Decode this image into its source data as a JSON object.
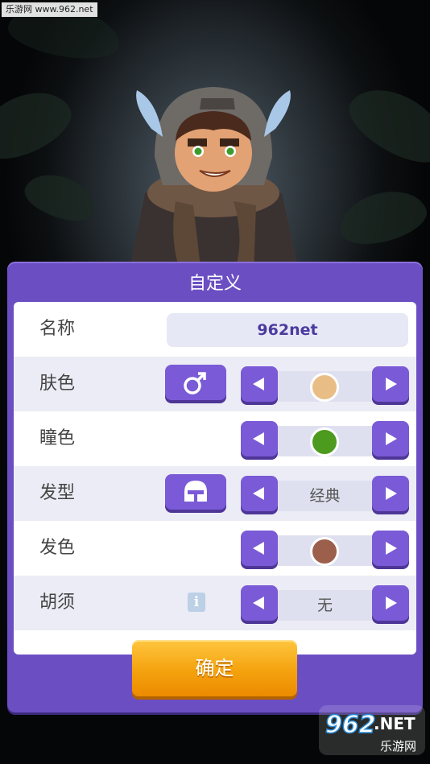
{
  "watermark_top": "乐游网 www.962.net",
  "watermark_bottom": {
    "brand": "962",
    "suffix": ".NET",
    "sub": "乐游网"
  },
  "panel": {
    "title": "自定义",
    "confirm_label": "确定"
  },
  "rows": {
    "name": {
      "label": "名称",
      "value": "962net"
    },
    "skin": {
      "label": "肤色",
      "gender_icon": "male-symbol-icon",
      "color": "#e8bd86"
    },
    "eye": {
      "label": "瞳色",
      "color": "#4c9a1e"
    },
    "hair": {
      "label": "发型",
      "helmet_icon": "helmet-icon",
      "value": "经典"
    },
    "hair_color": {
      "label": "发色",
      "color": "#9c5f4c"
    },
    "beard": {
      "label": "胡须",
      "info_icon": "info-icon",
      "value": "无"
    }
  },
  "colors": {
    "panel": "#6b4fc2",
    "button": "#7a5ad6",
    "confirm": "#f4a20e"
  }
}
